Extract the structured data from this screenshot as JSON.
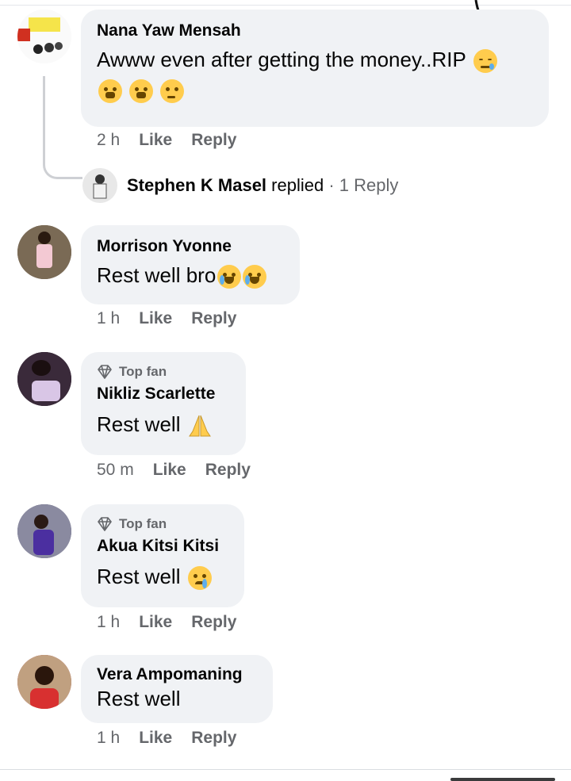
{
  "comments": [
    {
      "author": "Nana Yaw Mensah",
      "text_line1": "Awww even after getting the money..RIP",
      "time": "2 h",
      "like": "Like",
      "reply": "Reply",
      "emojis": [
        "sleepy-face",
        "tired-face",
        "tired-face",
        "thinking-face"
      ]
    },
    {
      "author": "Morrison Yvonne",
      "text": "Rest well bro",
      "time": "1 h",
      "like": "Like",
      "reply": "Reply",
      "emojis": [
        "loudly-crying-face",
        "loudly-crying-face"
      ]
    },
    {
      "badge": "Top fan",
      "author": "Nikliz Scarlette",
      "text": "Rest well",
      "time": "50 m",
      "like": "Like",
      "reply": "Reply",
      "emojis": [
        "folded-hands"
      ]
    },
    {
      "badge": "Top fan",
      "author": "Akua Kitsi Kitsi",
      "text": "Rest well",
      "time": "1 h",
      "like": "Like",
      "reply": "Reply",
      "emojis": [
        "crying-face"
      ]
    },
    {
      "author": "Vera Ampomaning",
      "text": "Rest well",
      "time": "1 h",
      "like": "Like",
      "reply": "Reply"
    }
  ],
  "reply_thread": {
    "name": "Stephen K Masel",
    "action": "replied",
    "count": "· 1 Reply"
  },
  "colors": {
    "bubble": "#f0f2f5",
    "meta_text": "#65676b",
    "emoji_yellow": "#ffcc4d"
  }
}
